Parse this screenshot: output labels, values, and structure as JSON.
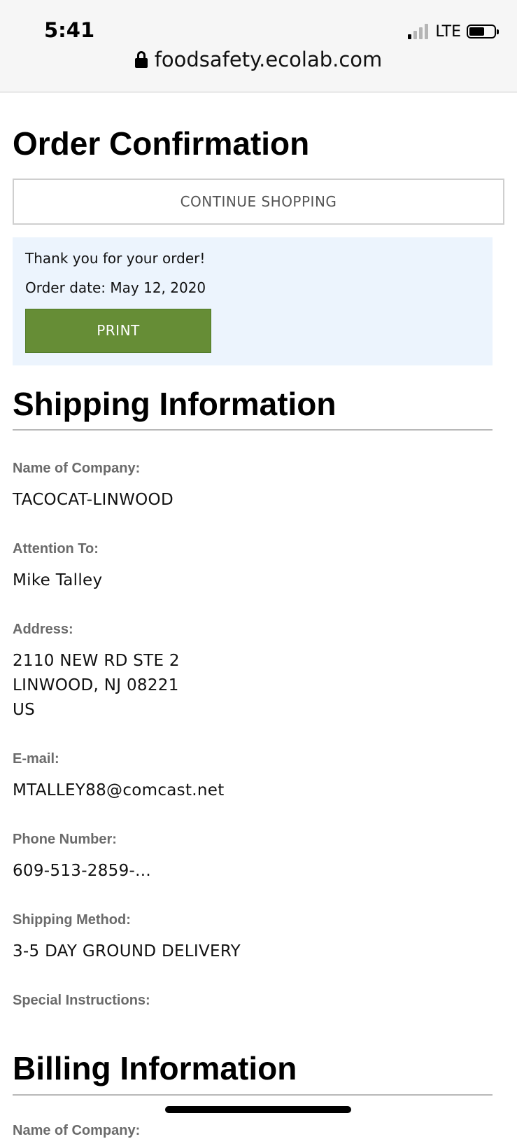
{
  "status_bar": {
    "time": "5:41",
    "network": "LTE"
  },
  "browser": {
    "url": "foodsafety.ecolab.com"
  },
  "page": {
    "title": "Order Confirmation",
    "continue_label": "CONTINUE SHOPPING",
    "thank_you": "Thank you for your order!",
    "order_date": "Order date: May 12, 2020",
    "print_label": "PRINT"
  },
  "shipping": {
    "title": "Shipping Information",
    "fields": [
      {
        "label": "Name of Company:",
        "value": "TACOCAT-LINWOOD"
      },
      {
        "label": "Attention To:",
        "value": "Mike Talley"
      },
      {
        "label": "Address:",
        "lines": [
          "2110 NEW RD STE 2",
          "LINWOOD, NJ 08221",
          "US"
        ]
      },
      {
        "label": "E-mail:",
        "value": "MTALLEY88@comcast.net"
      },
      {
        "label": "Phone Number:",
        "value": "609-513-2859-..."
      },
      {
        "label": "Shipping Method:",
        "value": "3-5 DAY GROUND DELIVERY"
      },
      {
        "label": "Special Instructions:",
        "value": ""
      }
    ]
  },
  "billing": {
    "title": "Billing Information",
    "first_label": "Name of Company:"
  },
  "colors": {
    "print_button": "#668d36",
    "thanks_background": "#ecf4fd"
  }
}
